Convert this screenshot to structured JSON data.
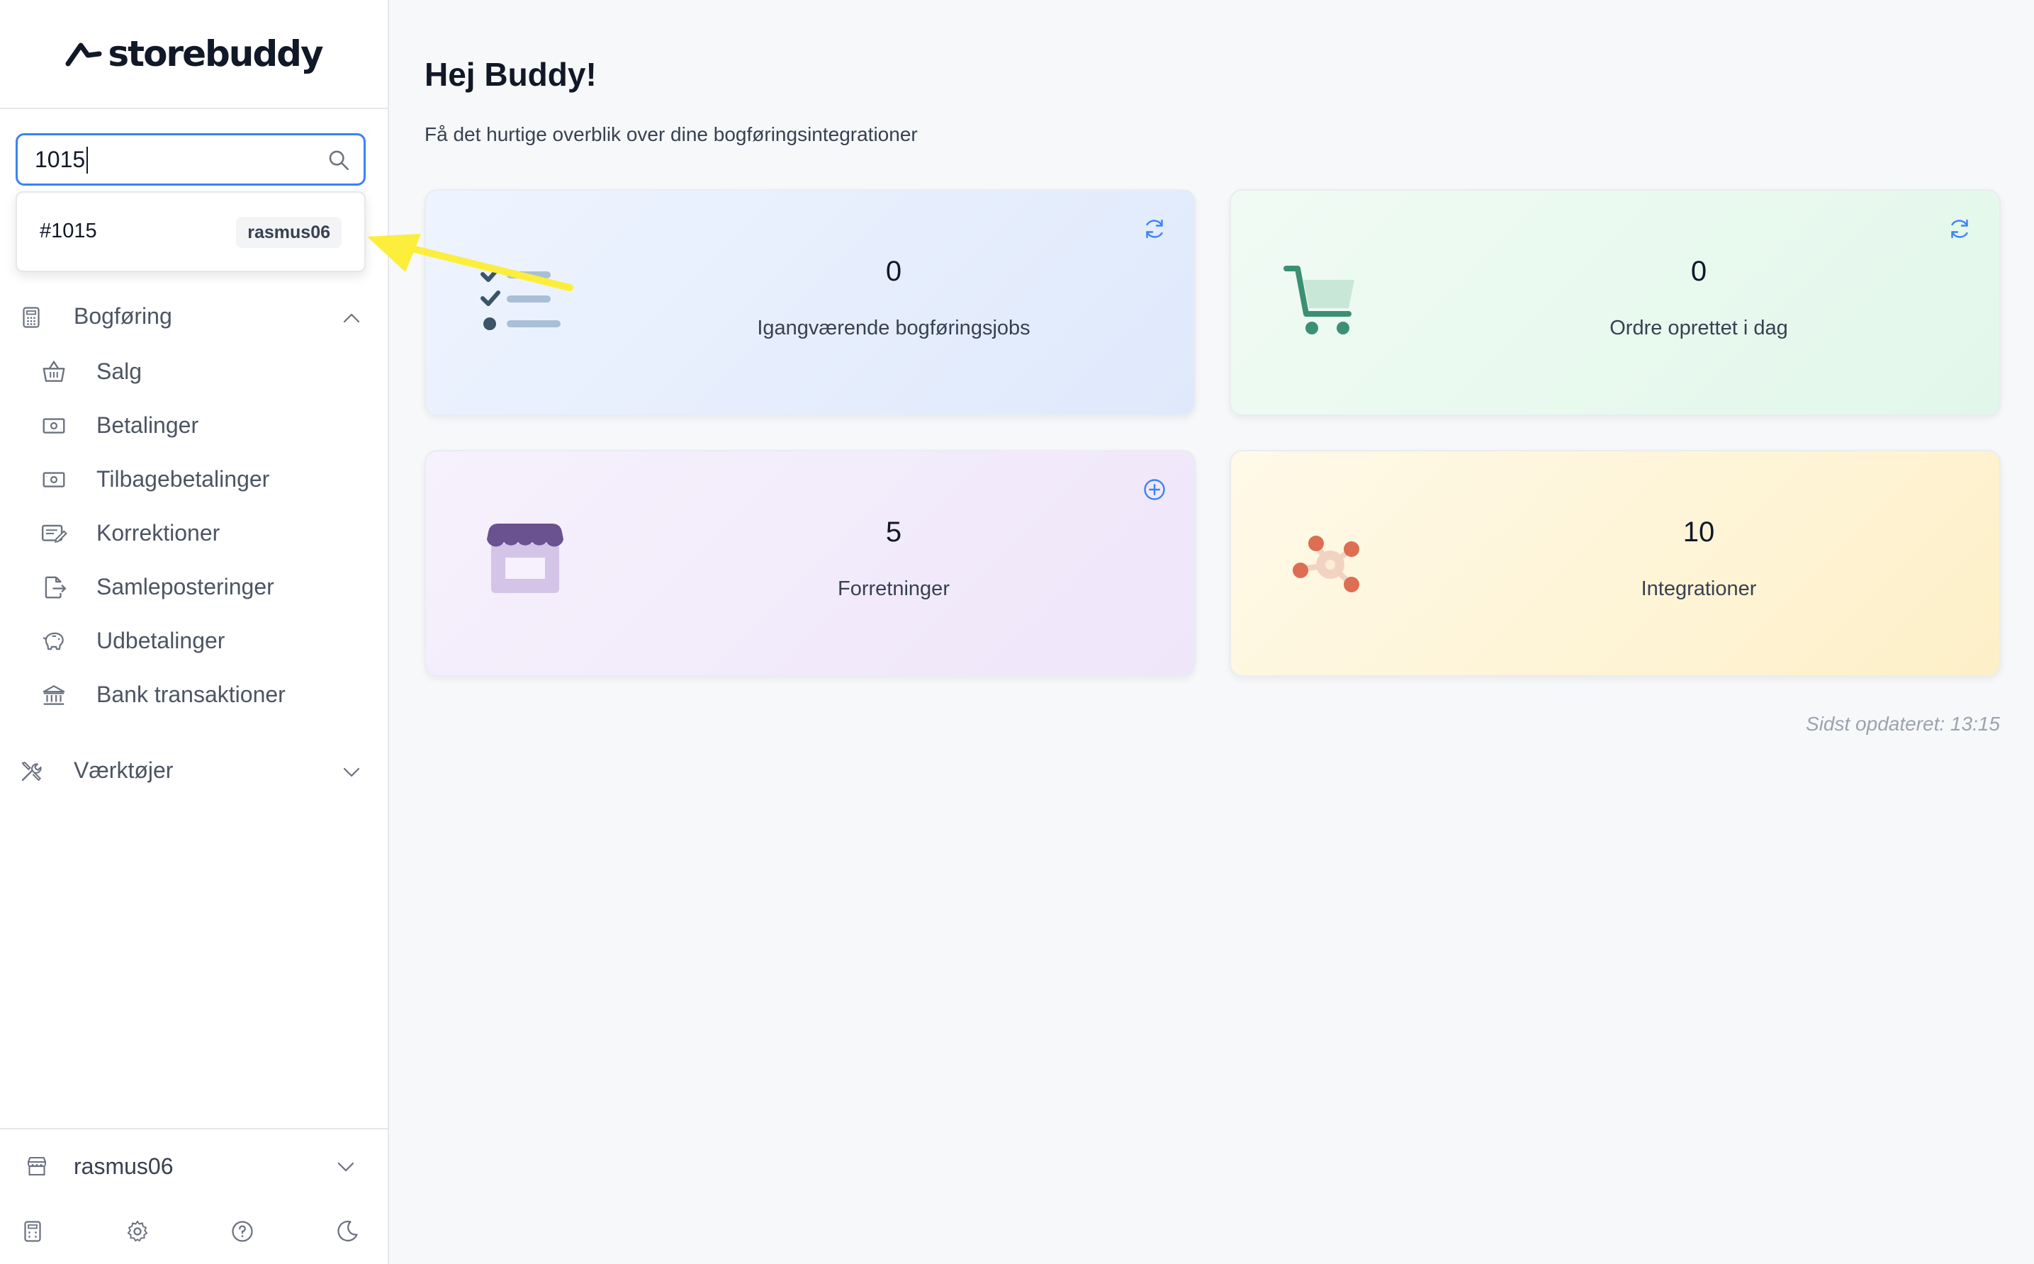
{
  "brand": {
    "name": "storebuddy"
  },
  "search": {
    "value": "1015",
    "placeholder": ""
  },
  "search_results": [
    {
      "id": "#1015",
      "store": "rasmus06"
    }
  ],
  "nav": {
    "bogforing": {
      "label": "Bogføring",
      "expanded": true,
      "items": [
        {
          "label": "Salg",
          "icon": "basket-icon"
        },
        {
          "label": "Betalinger",
          "icon": "banknote-icon"
        },
        {
          "label": "Tilbagebetalinger",
          "icon": "banknote-icon"
        },
        {
          "label": "Korrektioner",
          "icon": "edit-card-icon"
        },
        {
          "label": "Samleposteringer",
          "icon": "file-export-icon"
        },
        {
          "label": "Udbetalinger",
          "icon": "piggy-bank-icon"
        },
        {
          "label": "Bank transaktioner",
          "icon": "bank-icon"
        }
      ]
    },
    "vaerktojer": {
      "label": "Værktøjer",
      "expanded": false
    }
  },
  "footer": {
    "account": "rasmus06",
    "icons": [
      "calculator-icon",
      "gear-icon",
      "help-icon",
      "moon-icon"
    ]
  },
  "main": {
    "title": "Hej Buddy!",
    "subtitle": "Få det hurtige overblik over dine bogføringsintegrationer",
    "cards": [
      {
        "value": "0",
        "label": "Igangværende bogføringsjobs",
        "action": "refresh-icon"
      },
      {
        "value": "0",
        "label": "Ordre oprettet i dag",
        "action": "refresh-icon"
      },
      {
        "value": "5",
        "label": "Forretninger",
        "action": "plus-circle-icon"
      },
      {
        "value": "10",
        "label": "Integrationer",
        "action": ""
      }
    ],
    "last_updated": "Sidst opdateret: 13:15"
  },
  "colors": {
    "accent": "#3b82f6",
    "annotation_arrow": "#fcee3a"
  }
}
